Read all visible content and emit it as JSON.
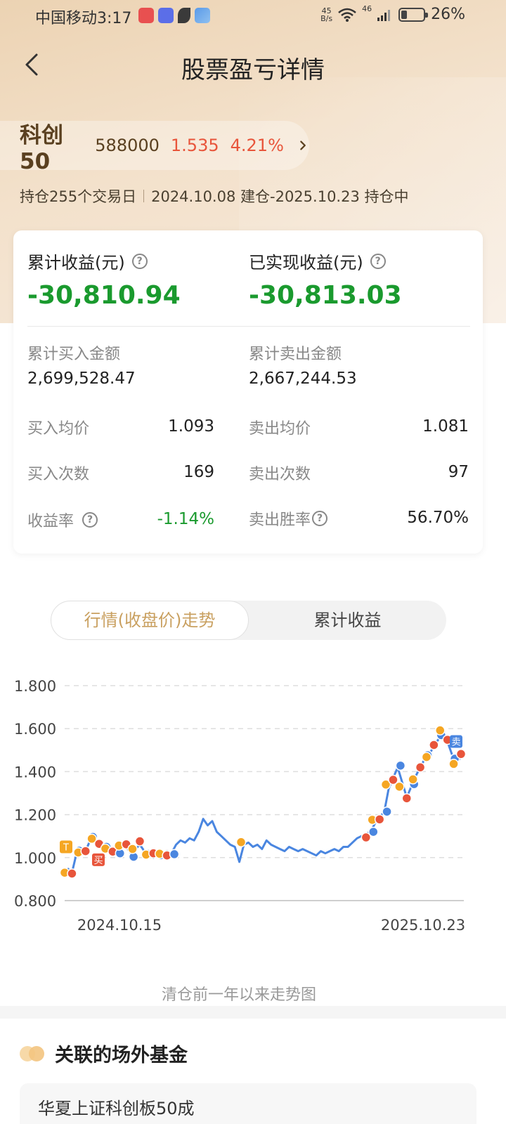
{
  "status_bar": {
    "carrier": "中国移动",
    "time": "3:17",
    "net_speed_value": "45",
    "net_speed_unit": "B/s",
    "signal": "46",
    "battery": "26%",
    "battery_level": 0.26
  },
  "header": {
    "title": "股票盈亏详情"
  },
  "stock": {
    "name": "科创50",
    "code": "588000",
    "price": "1.535",
    "change_pct": "4.21%"
  },
  "holding": {
    "days": "持仓255个交易日",
    "period": "2024.10.08 建仓-2025.10.23 持仓中"
  },
  "summary": {
    "cumulative_label": "累计收益(元)",
    "cumulative_value": "-30,810.94",
    "realized_label": "已实现收益(元)",
    "realized_value": "-30,813.03",
    "buy_amount_label": "累计买入金额",
    "buy_amount_value": "2,699,528.47",
    "sell_amount_label": "累计卖出金额",
    "sell_amount_value": "2,667,244.53",
    "buy_avg_label": "买入均价",
    "buy_avg_value": "1.093",
    "sell_avg_label": "卖出均价",
    "sell_avg_value": "1.081",
    "buy_count_label": "买入次数",
    "buy_count_value": "169",
    "sell_count_label": "卖出次数",
    "sell_count_value": "97",
    "yield_label": "收益率",
    "yield_value": "-1.14%",
    "win_rate_label": "卖出胜率",
    "win_rate_value": "56.70%",
    "help_symbol": "?"
  },
  "tabs": [
    {
      "label": "行情(收盘价)走势",
      "active": true
    },
    {
      "label": "累计收益",
      "active": false
    }
  ],
  "chart_data": {
    "type": "line",
    "y_ticks": [
      "1.800",
      "1.600",
      "1.400",
      "1.200",
      "1.000",
      "0.800"
    ],
    "ylim": [
      0.8,
      1.8
    ],
    "x_tick_labels": [
      "2024.10.15",
      "2025.10.23"
    ],
    "grid": true,
    "line_color": "#4a86e0",
    "series": [
      {
        "values": [
          0.95,
          0.93,
          1.02,
          1.04,
          1.03,
          1.08,
          1.1,
          1.06,
          1.03,
          1.05,
          1.02,
          1.04,
          1.06,
          1.05,
          1.02,
          1.04,
          1.06,
          1.03,
          1.01,
          1.0,
          1.02,
          1.01,
          1.03,
          1.02,
          1.06,
          1.08,
          1.07,
          1.09,
          1.08,
          1.12,
          1.18,
          1.15,
          1.17,
          1.12,
          1.1,
          1.08,
          1.06,
          1.05,
          0.98,
          1.06,
          1.07,
          1.05,
          1.06,
          1.04,
          1.08,
          1.06,
          1.05,
          1.04,
          1.03,
          1.05,
          1.04,
          1.03,
          1.04,
          1.03,
          1.02,
          1.01,
          1.03,
          1.02,
          1.03,
          1.04,
          1.03,
          1.05,
          1.05,
          1.07,
          1.09,
          1.1,
          1.11,
          1.12,
          1.16,
          1.19,
          1.21,
          1.32,
          1.37,
          1.42,
          1.35,
          1.28,
          1.33,
          1.38,
          1.42,
          1.46,
          1.48,
          1.52,
          1.55,
          1.6,
          1.54,
          1.48,
          1.44,
          1.47
        ]
      }
    ],
    "trade_markers": [
      {
        "label": "T",
        "color": "#f5a623"
      },
      {
        "label": "买",
        "color": "#e8553b"
      },
      {
        "label": "卖",
        "color": "#4a86e0"
      }
    ],
    "dot_colors": {
      "buy": "#e8553b",
      "sell": "#4a86e0",
      "t": "#f5a623"
    }
  },
  "chart_caption": "清仓前一年以来走势图",
  "related_funds": {
    "title": "关联的场外基金",
    "first_item": "华夏上证科创板50成"
  },
  "colors": {
    "loss_green": "#1a9a2e",
    "gain_red": "#e8553b",
    "tab_active_text": "#c9a060"
  }
}
